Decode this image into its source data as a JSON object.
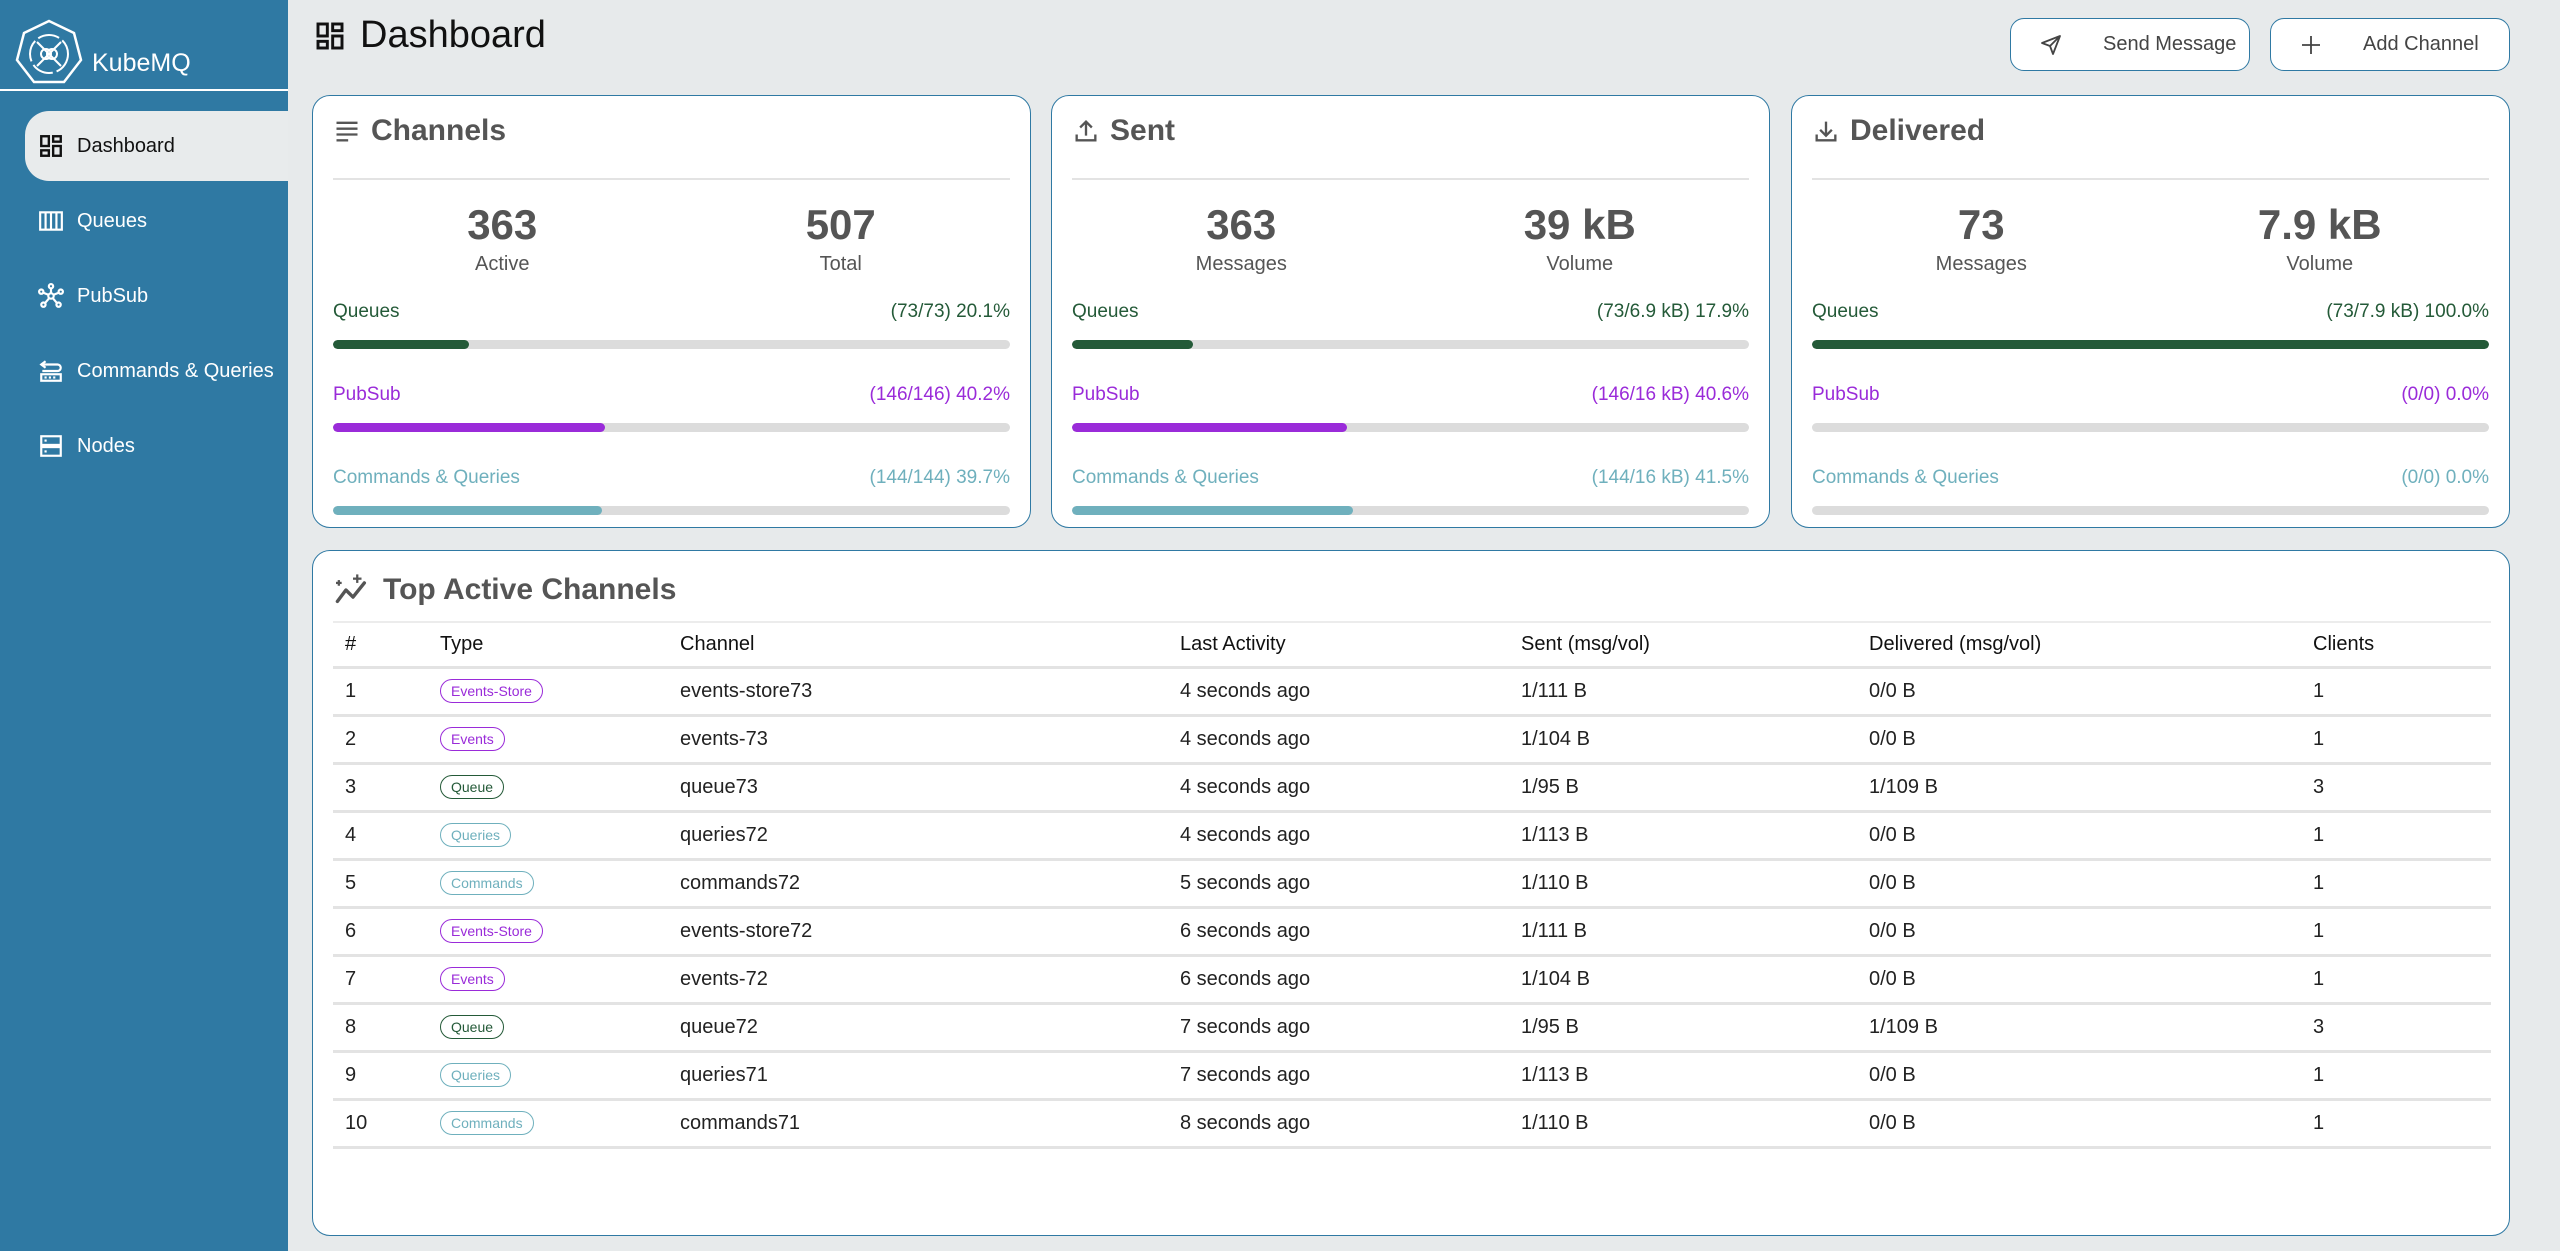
{
  "app": {
    "name": "KubeMQ"
  },
  "sidebar": {
    "items": [
      {
        "label": "Dashboard",
        "icon": "dashboard-icon",
        "active": true
      },
      {
        "label": "Queues",
        "icon": "queues-icon",
        "active": false
      },
      {
        "label": "PubSub",
        "icon": "pubsub-icon",
        "active": false
      },
      {
        "label": "Commands & Queries",
        "icon": "commands-queries-icon",
        "active": false
      },
      {
        "label": "Nodes",
        "icon": "nodes-icon",
        "active": false
      }
    ]
  },
  "header": {
    "title": "Dashboard",
    "send_message_label": "Send Message",
    "add_channel_label": "Add Channel"
  },
  "colors": {
    "sidebar": "#2f79a3",
    "queues": "#245a38",
    "pubsub": "#9a2bd9",
    "commands_queries": "#6fb0bd"
  },
  "cards": {
    "channels": {
      "title": "Channels",
      "stats": [
        {
          "value": "363",
          "label": "Active"
        },
        {
          "value": "507",
          "label": "Total"
        }
      ],
      "bars": [
        {
          "label": "Queues",
          "detail": "(73/73) 20.1%",
          "percent": 20.1,
          "color": "#245a38"
        },
        {
          "label": "PubSub",
          "detail": "(146/146) 40.2%",
          "percent": 40.2,
          "color": "#9a2bd9"
        },
        {
          "label": "Commands & Queries",
          "detail": "(144/144) 39.7%",
          "percent": 39.7,
          "color": "#6fb0bd"
        }
      ]
    },
    "sent": {
      "title": "Sent",
      "stats": [
        {
          "value": "363",
          "label": "Messages"
        },
        {
          "value": "39 kB",
          "label": "Volume"
        }
      ],
      "bars": [
        {
          "label": "Queues",
          "detail": "(73/6.9 kB) 17.9%",
          "percent": 17.9,
          "color": "#245a38"
        },
        {
          "label": "PubSub",
          "detail": "(146/16 kB) 40.6%",
          "percent": 40.6,
          "color": "#9a2bd9"
        },
        {
          "label": "Commands & Queries",
          "detail": "(144/16 kB) 41.5%",
          "percent": 41.5,
          "color": "#6fb0bd"
        }
      ]
    },
    "delivered": {
      "title": "Delivered",
      "stats": [
        {
          "value": "73",
          "label": "Messages"
        },
        {
          "value": "7.9 kB",
          "label": "Volume"
        }
      ],
      "bars": [
        {
          "label": "Queues",
          "detail": "(73/7.9 kB) 100.0%",
          "percent": 100.0,
          "color": "#245a38"
        },
        {
          "label": "PubSub",
          "detail": "(0/0) 0.0%",
          "percent": 0.0,
          "color": "#9a2bd9"
        },
        {
          "label": "Commands & Queries",
          "detail": "(0/0) 0.0%",
          "percent": 0.0,
          "color": "#6fb0bd"
        }
      ]
    }
  },
  "top_channels": {
    "title": "Top Active Channels",
    "columns": [
      "#",
      "Type",
      "Channel",
      "Last Activity",
      "Sent (msg/vol)",
      "Delivered (msg/vol)",
      "Clients"
    ],
    "rows": [
      {
        "n": "1",
        "type": "Events-Store",
        "kind": "pubsub",
        "channel": "events-store73",
        "last": "4 seconds ago",
        "sent": "1/111 B",
        "delivered": "0/0 B",
        "clients": "1"
      },
      {
        "n": "2",
        "type": "Events",
        "kind": "pubsub",
        "channel": "events-73",
        "last": "4 seconds ago",
        "sent": "1/104 B",
        "delivered": "0/0 B",
        "clients": "1"
      },
      {
        "n": "3",
        "type": "Queue",
        "kind": "queue",
        "channel": "queue73",
        "last": "4 seconds ago",
        "sent": "1/95 B",
        "delivered": "1/109 B",
        "clients": "3"
      },
      {
        "n": "4",
        "type": "Queries",
        "kind": "cq",
        "channel": "queries72",
        "last": "4 seconds ago",
        "sent": "1/113 B",
        "delivered": "0/0 B",
        "clients": "1"
      },
      {
        "n": "5",
        "type": "Commands",
        "kind": "cq",
        "channel": "commands72",
        "last": "5 seconds ago",
        "sent": "1/110 B",
        "delivered": "0/0 B",
        "clients": "1"
      },
      {
        "n": "6",
        "type": "Events-Store",
        "kind": "pubsub",
        "channel": "events-store72",
        "last": "6 seconds ago",
        "sent": "1/111 B",
        "delivered": "0/0 B",
        "clients": "1"
      },
      {
        "n": "7",
        "type": "Events",
        "kind": "pubsub",
        "channel": "events-72",
        "last": "6 seconds ago",
        "sent": "1/104 B",
        "delivered": "0/0 B",
        "clients": "1"
      },
      {
        "n": "8",
        "type": "Queue",
        "kind": "queue",
        "channel": "queue72",
        "last": "7 seconds ago",
        "sent": "1/95 B",
        "delivered": "1/109 B",
        "clients": "3"
      },
      {
        "n": "9",
        "type": "Queries",
        "kind": "cq",
        "channel": "queries71",
        "last": "7 seconds ago",
        "sent": "1/113 B",
        "delivered": "0/0 B",
        "clients": "1"
      },
      {
        "n": "10",
        "type": "Commands",
        "kind": "cq",
        "channel": "commands71",
        "last": "8 seconds ago",
        "sent": "1/110 B",
        "delivered": "0/0 B",
        "clients": "1"
      }
    ]
  }
}
